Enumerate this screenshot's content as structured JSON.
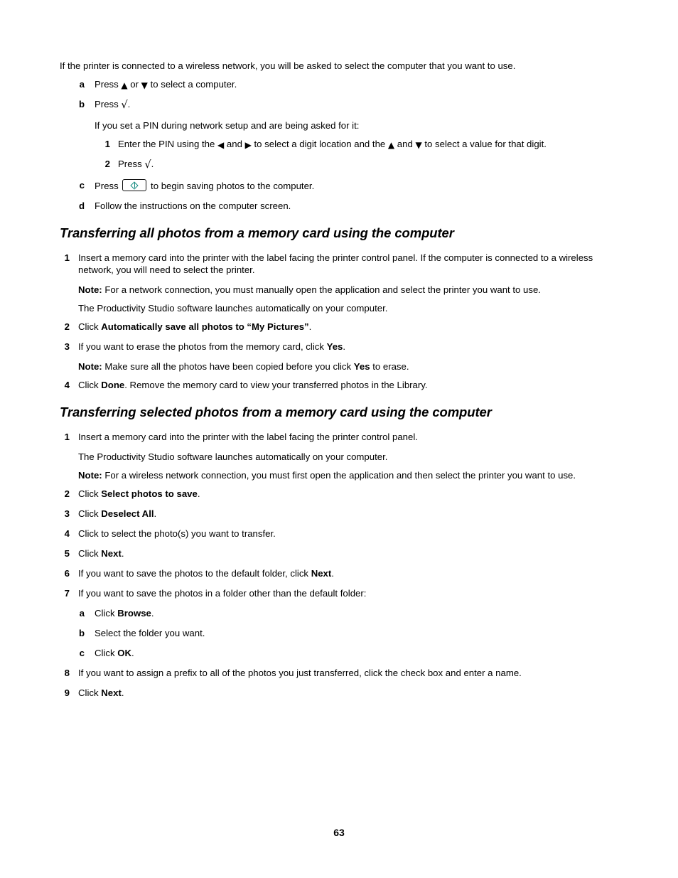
{
  "document": {
    "page_number": "63"
  },
  "intro": {
    "lead": "If the printer is connected to a wireless network, you will be asked to select the computer that you want to use.",
    "steps": [
      {
        "marker": "a",
        "text_before": "Press ",
        "glyph_up": "▲",
        "text_mid": " or ",
        "glyph_down": "▼",
        "text_after": " to select a computer."
      },
      {
        "marker": "b",
        "text_before": "Press ",
        "glyph_check": "√",
        "text_after": ".",
        "sub_lead": "If you set a PIN during network setup and are being asked for it:",
        "substeps": [
          {
            "marker": "1",
            "t1": "Enter the PIN using the ",
            "g_left": "◀",
            "t2": " and ",
            "g_right": "▶",
            "t3": " to select a digit location and the ",
            "g_up": "▲",
            "t4": " and ",
            "g_down": "▼",
            "t5": " to select a value for that digit."
          },
          {
            "marker": "2",
            "t1": "Press ",
            "g_check": "√",
            "t2": "."
          }
        ]
      },
      {
        "marker": "c",
        "text_before": "Press ",
        "icon": "start-button-icon",
        "text_after": " to begin saving photos to the computer."
      },
      {
        "marker": "d",
        "text": "Follow the instructions on the computer screen."
      }
    ]
  },
  "section_all_photos": {
    "heading": "Transferring all photos from a memory card using the computer",
    "steps": [
      {
        "marker": "1",
        "text": "Insert a memory card into the printer with the label facing the printer control panel. If the computer is connected to a wireless network, you will need to select the printer.",
        "notes": [
          {
            "label": "Note:",
            "text": " For a network connection, you must manually open the application and select the printer you want to use."
          }
        ],
        "follow": "The Productivity Studio software launches automatically on your computer."
      },
      {
        "marker": "2",
        "prefix": "Click ",
        "bold": "Automatically save all photos to “My Pictures”",
        "suffix": "."
      },
      {
        "marker": "3",
        "prefix": "If you want to erase the photos from the memory card, click ",
        "bold": "Yes",
        "suffix": ".",
        "note_label": "Note:",
        "note_t1": " Make sure all the photos have been copied before you click ",
        "note_bold": "Yes",
        "note_t2": " to erase."
      },
      {
        "marker": "4",
        "prefix": "Click ",
        "bold": "Done",
        "suffix": ". Remove the memory card to view your transferred photos in the Library."
      }
    ]
  },
  "section_selected_photos": {
    "heading": "Transferring selected photos from a memory card using the computer",
    "steps": [
      {
        "marker": "1",
        "text": "Insert a memory card into the printer with the label facing the printer control panel.",
        "follow": "The Productivity Studio software launches automatically on your computer.",
        "note_label": "Note:",
        "note_text": " For a wireless network connection, you must first open the application and then select the printer you want to use."
      },
      {
        "marker": "2",
        "prefix": "Click ",
        "bold": "Select photos to save",
        "suffix": "."
      },
      {
        "marker": "3",
        "prefix": "Click ",
        "bold": "Deselect All",
        "suffix": "."
      },
      {
        "marker": "4",
        "prefix": "Click to select the photo(s) you want to transfer.",
        "bold": "",
        "suffix": ""
      },
      {
        "marker": "5",
        "prefix": "Click ",
        "bold": "Next",
        "suffix": "."
      },
      {
        "marker": "6",
        "prefix": "If you want to save the photos to the default folder, click ",
        "bold": "Next",
        "suffix": "."
      },
      {
        "marker": "7",
        "prefix": "If you want to save the photos in a folder other than the default folder:",
        "bold": "",
        "suffix": "",
        "substeps": [
          {
            "marker": "a",
            "prefix": "Click ",
            "bold": "Browse",
            "suffix": "."
          },
          {
            "marker": "b",
            "prefix": "Select the folder you want.",
            "bold": "",
            "suffix": ""
          },
          {
            "marker": "c",
            "prefix": "Click ",
            "bold": "OK",
            "suffix": "."
          }
        ]
      },
      {
        "marker": "8",
        "prefix": "If you want to assign a prefix to all of the photos you just transferred, click the check box and enter a name.",
        "bold": "",
        "suffix": ""
      },
      {
        "marker": "9",
        "prefix": "Click ",
        "bold": "Next",
        "suffix": "."
      }
    ]
  },
  "colors": {
    "icon_teal": "#11897f",
    "text": "#000000",
    "background": "#ffffff"
  }
}
